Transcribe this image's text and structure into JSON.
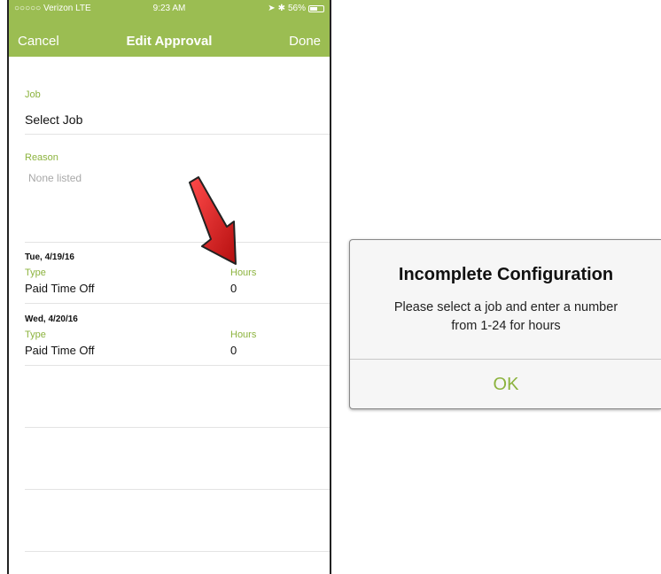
{
  "status_bar": {
    "carrier": "○○○○○ Verizon  LTE",
    "time": "9:23 AM",
    "battery_text": "56%",
    "battery_level": 0.56
  },
  "nav": {
    "cancel": "Cancel",
    "title": "Edit Approval",
    "done": "Done"
  },
  "form": {
    "job_label": "Job",
    "job_value": "Select Job",
    "reason_label": "Reason",
    "reason_placeholder": "None listed"
  },
  "days": [
    {
      "date": "Tue, 4/19/16",
      "type_label": "Type",
      "hours_label": "Hours",
      "type_value": "Paid Time Off",
      "hours_value": "0"
    },
    {
      "date": "Wed, 4/20/16",
      "type_label": "Type",
      "hours_label": "Hours",
      "type_value": "Paid Time Off",
      "hours_value": "0"
    }
  ],
  "alert": {
    "title": "Incomplete Configuration",
    "message_line1": "Please select a job and enter a number",
    "message_line2": "from 1-24 for hours",
    "ok": "OK"
  },
  "colors": {
    "accent_green": "#9bbd52",
    "label_green": "#8cb33e",
    "arrow_red": "#d42020"
  }
}
